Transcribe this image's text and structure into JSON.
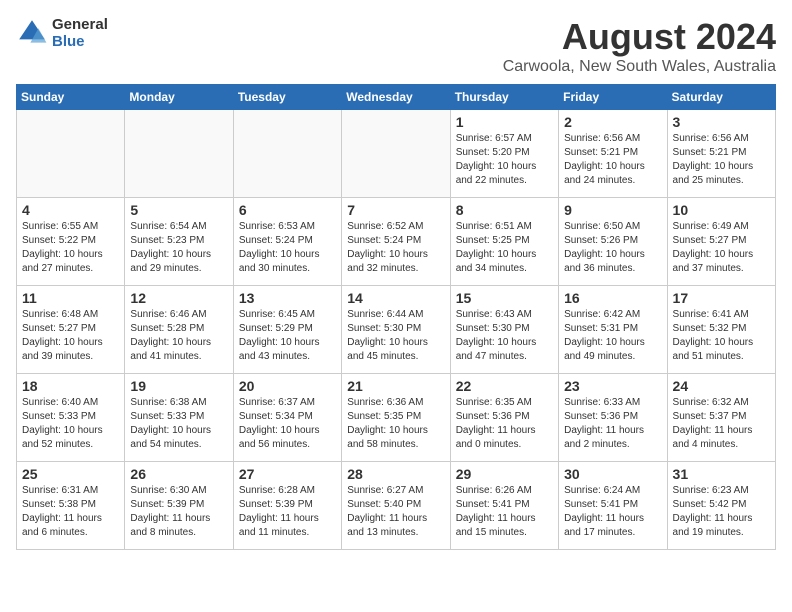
{
  "logo": {
    "line1": "General",
    "line2": "Blue"
  },
  "title": "August 2024",
  "subtitle": "Carwoola, New South Wales, Australia",
  "days_of_week": [
    "Sunday",
    "Monday",
    "Tuesday",
    "Wednesday",
    "Thursday",
    "Friday",
    "Saturday"
  ],
  "weeks": [
    [
      {
        "day": "",
        "info": ""
      },
      {
        "day": "",
        "info": ""
      },
      {
        "day": "",
        "info": ""
      },
      {
        "day": "",
        "info": ""
      },
      {
        "day": "1",
        "info": "Sunrise: 6:57 AM\nSunset: 5:20 PM\nDaylight: 10 hours\nand 22 minutes."
      },
      {
        "day": "2",
        "info": "Sunrise: 6:56 AM\nSunset: 5:21 PM\nDaylight: 10 hours\nand 24 minutes."
      },
      {
        "day": "3",
        "info": "Sunrise: 6:56 AM\nSunset: 5:21 PM\nDaylight: 10 hours\nand 25 minutes."
      }
    ],
    [
      {
        "day": "4",
        "info": "Sunrise: 6:55 AM\nSunset: 5:22 PM\nDaylight: 10 hours\nand 27 minutes."
      },
      {
        "day": "5",
        "info": "Sunrise: 6:54 AM\nSunset: 5:23 PM\nDaylight: 10 hours\nand 29 minutes."
      },
      {
        "day": "6",
        "info": "Sunrise: 6:53 AM\nSunset: 5:24 PM\nDaylight: 10 hours\nand 30 minutes."
      },
      {
        "day": "7",
        "info": "Sunrise: 6:52 AM\nSunset: 5:24 PM\nDaylight: 10 hours\nand 32 minutes."
      },
      {
        "day": "8",
        "info": "Sunrise: 6:51 AM\nSunset: 5:25 PM\nDaylight: 10 hours\nand 34 minutes."
      },
      {
        "day": "9",
        "info": "Sunrise: 6:50 AM\nSunset: 5:26 PM\nDaylight: 10 hours\nand 36 minutes."
      },
      {
        "day": "10",
        "info": "Sunrise: 6:49 AM\nSunset: 5:27 PM\nDaylight: 10 hours\nand 37 minutes."
      }
    ],
    [
      {
        "day": "11",
        "info": "Sunrise: 6:48 AM\nSunset: 5:27 PM\nDaylight: 10 hours\nand 39 minutes."
      },
      {
        "day": "12",
        "info": "Sunrise: 6:46 AM\nSunset: 5:28 PM\nDaylight: 10 hours\nand 41 minutes."
      },
      {
        "day": "13",
        "info": "Sunrise: 6:45 AM\nSunset: 5:29 PM\nDaylight: 10 hours\nand 43 minutes."
      },
      {
        "day": "14",
        "info": "Sunrise: 6:44 AM\nSunset: 5:30 PM\nDaylight: 10 hours\nand 45 minutes."
      },
      {
        "day": "15",
        "info": "Sunrise: 6:43 AM\nSunset: 5:30 PM\nDaylight: 10 hours\nand 47 minutes."
      },
      {
        "day": "16",
        "info": "Sunrise: 6:42 AM\nSunset: 5:31 PM\nDaylight: 10 hours\nand 49 minutes."
      },
      {
        "day": "17",
        "info": "Sunrise: 6:41 AM\nSunset: 5:32 PM\nDaylight: 10 hours\nand 51 minutes."
      }
    ],
    [
      {
        "day": "18",
        "info": "Sunrise: 6:40 AM\nSunset: 5:33 PM\nDaylight: 10 hours\nand 52 minutes."
      },
      {
        "day": "19",
        "info": "Sunrise: 6:38 AM\nSunset: 5:33 PM\nDaylight: 10 hours\nand 54 minutes."
      },
      {
        "day": "20",
        "info": "Sunrise: 6:37 AM\nSunset: 5:34 PM\nDaylight: 10 hours\nand 56 minutes."
      },
      {
        "day": "21",
        "info": "Sunrise: 6:36 AM\nSunset: 5:35 PM\nDaylight: 10 hours\nand 58 minutes."
      },
      {
        "day": "22",
        "info": "Sunrise: 6:35 AM\nSunset: 5:36 PM\nDaylight: 11 hours\nand 0 minutes."
      },
      {
        "day": "23",
        "info": "Sunrise: 6:33 AM\nSunset: 5:36 PM\nDaylight: 11 hours\nand 2 minutes."
      },
      {
        "day": "24",
        "info": "Sunrise: 6:32 AM\nSunset: 5:37 PM\nDaylight: 11 hours\nand 4 minutes."
      }
    ],
    [
      {
        "day": "25",
        "info": "Sunrise: 6:31 AM\nSunset: 5:38 PM\nDaylight: 11 hours\nand 6 minutes."
      },
      {
        "day": "26",
        "info": "Sunrise: 6:30 AM\nSunset: 5:39 PM\nDaylight: 11 hours\nand 8 minutes."
      },
      {
        "day": "27",
        "info": "Sunrise: 6:28 AM\nSunset: 5:39 PM\nDaylight: 11 hours\nand 11 minutes."
      },
      {
        "day": "28",
        "info": "Sunrise: 6:27 AM\nSunset: 5:40 PM\nDaylight: 11 hours\nand 13 minutes."
      },
      {
        "day": "29",
        "info": "Sunrise: 6:26 AM\nSunset: 5:41 PM\nDaylight: 11 hours\nand 15 minutes."
      },
      {
        "day": "30",
        "info": "Sunrise: 6:24 AM\nSunset: 5:41 PM\nDaylight: 11 hours\nand 17 minutes."
      },
      {
        "day": "31",
        "info": "Sunrise: 6:23 AM\nSunset: 5:42 PM\nDaylight: 11 hours\nand 19 minutes."
      }
    ]
  ]
}
